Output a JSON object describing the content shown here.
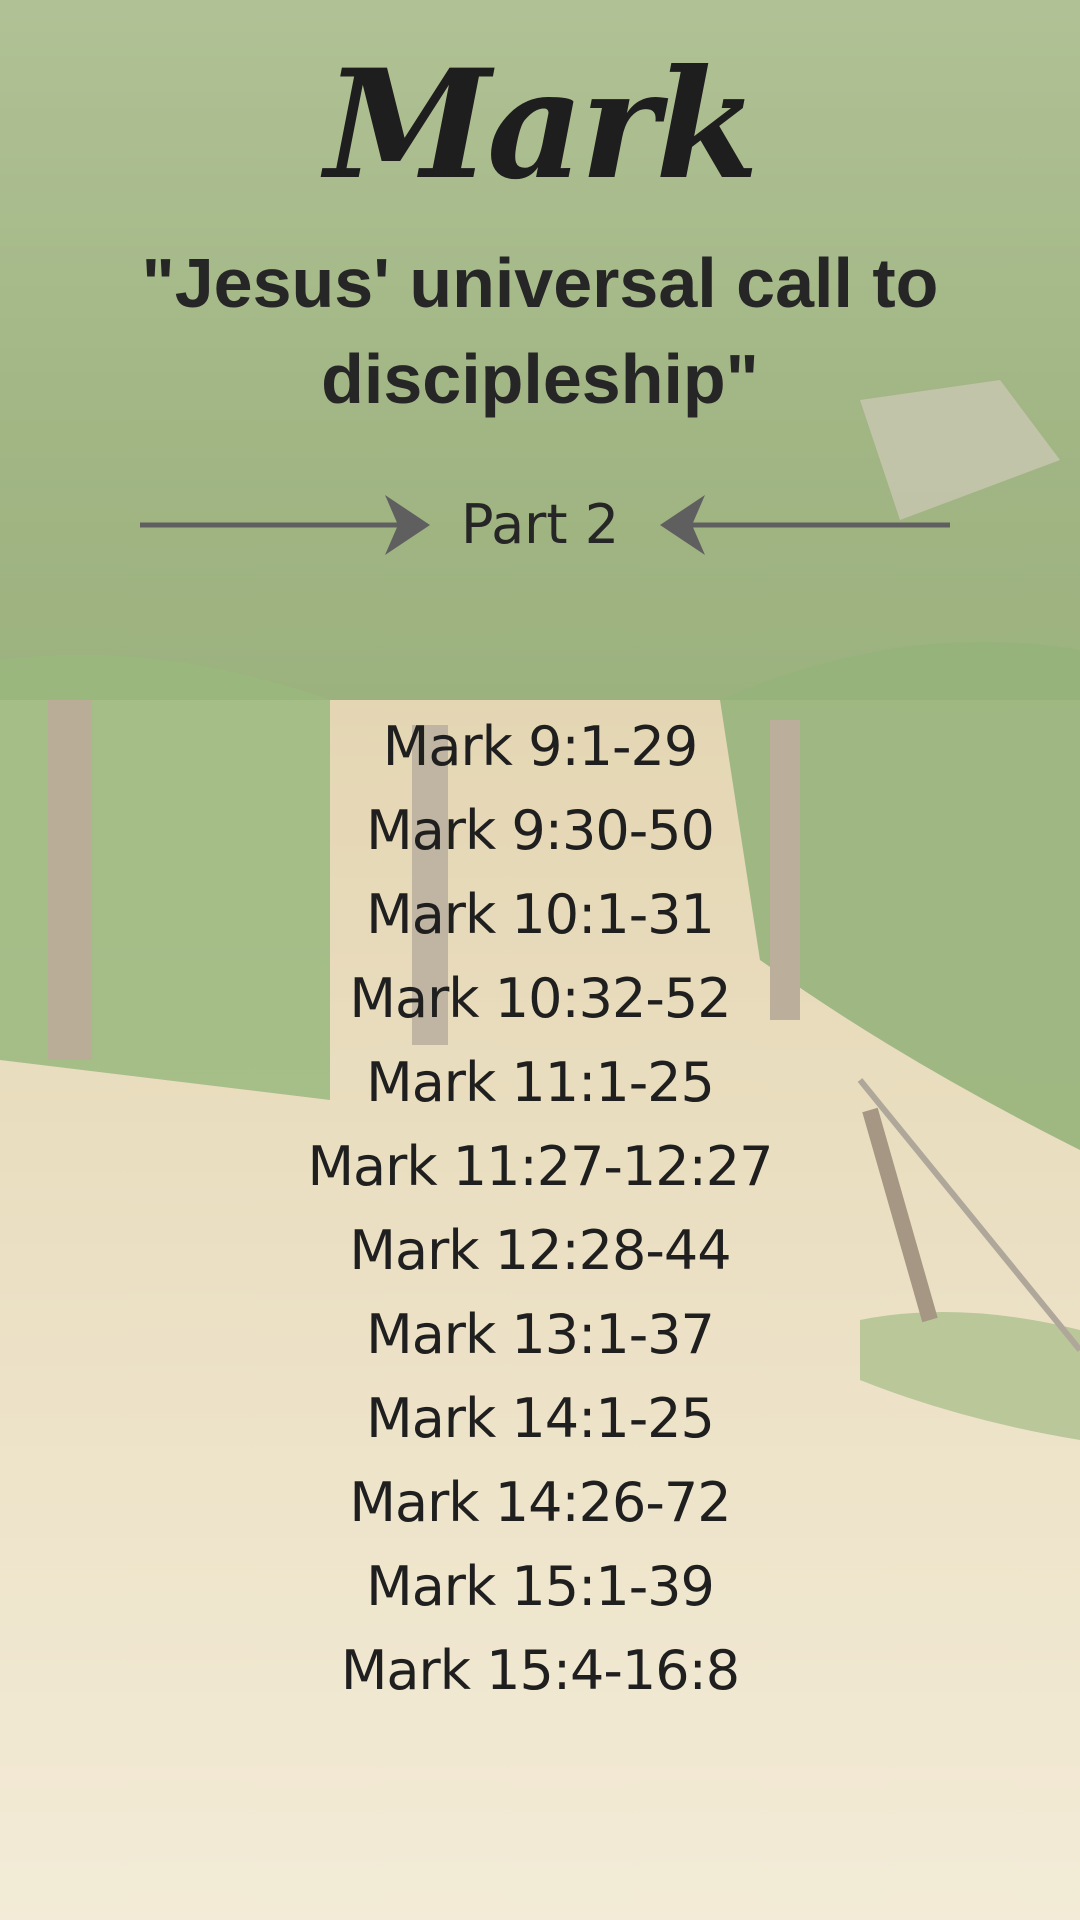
{
  "poster": {
    "book_title": "Mark",
    "subtitle": "\"Jesus' universal call to discipleship\"",
    "part_label": "Part 2",
    "passages": [
      "Mark 9:1-29",
      "Mark 9:30-50",
      "Mark 10:1-31",
      "Mark 10:32-52",
      "Mark 11:1-25",
      "Mark 11:27-12:27",
      "Mark 12:28-44",
      "Mark 13:1-37",
      "Mark 14:1-25",
      "Mark 14:26-72",
      "Mark 15:1-39",
      "Mark 15:4-16:8"
    ]
  },
  "icons": {
    "left_arrow": "arrow-right-icon",
    "right_arrow": "arrow-left-icon"
  },
  "colors": {
    "text": "#222222",
    "arrow": "#5f5f5f",
    "hill": "#7f9a58",
    "path": "#e2cf9c"
  }
}
